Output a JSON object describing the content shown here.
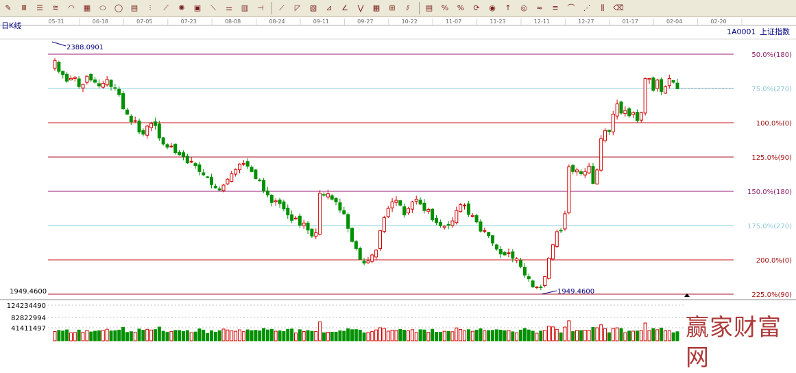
{
  "toolbar": {
    "groups": [
      [
        "draw-pencil-icon",
        "vertical-lines-icon",
        "horizontal-lines-icon",
        "fan-lines-icon",
        "arc-lines-icon",
        "price-channel-icon",
        "ellipse-icon",
        "circle-icon",
        "grid-lines-icon",
        "period-lines-icon",
        "fibonacci-fan-icon",
        "wheel-icon",
        "square-icon",
        "gann-line-icon",
        "speed-resistance-icon",
        "box-icon",
        "bracket-icon"
      ],
      [
        "trend-line-icon",
        "triangle-icon",
        "rectangle-pattern-icon",
        "fan-pattern-icon",
        "angle-icon",
        "zigzag-icon",
        "table-grid-icon",
        "grid-icon",
        "parallel-lines-icon"
      ],
      [
        "percent-lines-icon",
        "percent-icon",
        "percent-text-icon",
        "rotate-icon",
        "gold-icon",
        "arrow-up-icon",
        "gold-ratio-icon",
        "gold-wave-icon",
        "fib-retrace-icon",
        "fib-arc-icon",
        "fib-fan-icon",
        "fib-time-icon",
        "erase-icon"
      ]
    ]
  },
  "chart_data": {
    "type": "candlestick",
    "period_label": "日K线",
    "code": "1A0001",
    "name": "上证指数",
    "x_ticks": [
      "05-31",
      "06-18",
      "07-05",
      "07-23",
      "08-08",
      "08-24",
      "09-11",
      "09-27",
      "10-22",
      "11-07",
      "11-23",
      "12-11",
      "12-27",
      "01-17",
      "02-04",
      "02-20"
    ],
    "high_label": "2388.0901",
    "low_label": "1949.4600",
    "y_left_label": "1949.4600",
    "volume_ticks": [
      "124234490",
      "82822994",
      "41411497"
    ],
    "levels": [
      {
        "label": "50.0%(180)",
        "price": 2389.8,
        "color": "#9a1e74"
      },
      {
        "label": "75.0%(270)",
        "price": 2326.5,
        "color": "#8fd0e0"
      },
      {
        "label": "100.0%(0)",
        "price": 2263.2,
        "color": "#c8141e"
      },
      {
        "label": "125.0%(90)",
        "price": 2199.9,
        "color": "#a81428"
      },
      {
        "label": "150.0%(180)",
        "price": 2136.6,
        "color": "#9a1e74"
      },
      {
        "label": "175.0%(270)",
        "price": 2073.3,
        "color": "#8fd0e0"
      },
      {
        "label": "200.0%(0)",
        "price": 2010.0,
        "color": "#c8141e"
      },
      {
        "label": "225.0%(90)",
        "price": 1946.7,
        "color": "#a81428"
      }
    ],
    "last_close": 2326.5,
    "up_color": "#d00000",
    "down_color": "#009000",
    "closes": [
      2378,
      2358,
      2352,
      2340,
      2345,
      2347,
      2330,
      2334,
      2349,
      2342,
      2338,
      2331,
      2336,
      2343,
      2330,
      2327,
      2315,
      2289,
      2279,
      2265,
      2267,
      2246,
      2242,
      2257,
      2262,
      2258,
      2235,
      2224,
      2218,
      2220,
      2208,
      2204,
      2201,
      2189,
      2192,
      2184,
      2173,
      2167,
      2162,
      2149,
      2143,
      2139,
      2148,
      2159,
      2169,
      2177,
      2187,
      2188,
      2183,
      2173,
      2160,
      2156,
      2137,
      2130,
      2116,
      2119,
      2114,
      2104,
      2093,
      2083,
      2087,
      2074,
      2078,
      2065,
      2054,
      2060,
      2133,
      2130,
      2132,
      2122,
      2117,
      2102,
      2095,
      2068,
      2044,
      2031,
      2011,
      2004,
      2008,
      2019,
      2028,
      2064,
      2088,
      2105,
      2117,
      2120,
      2111,
      2093,
      2105,
      2117,
      2122,
      2113,
      2101,
      2103,
      2084,
      2079,
      2073,
      2072,
      2074,
      2082,
      2101,
      2112,
      2111,
      2094,
      2092,
      2080,
      2063,
      2064,
      2055,
      2041,
      2030,
      2021,
      2019,
      2023,
      2013,
      2012,
      1998,
      1982,
      1975,
      1960,
      1960,
      1959,
      1979,
      2013,
      2038,
      2062,
      2064,
      2095,
      2182,
      2173,
      2176,
      2169,
      2173,
      2183,
      2151,
      2176,
      2234,
      2249,
      2247,
      2279,
      2298,
      2281,
      2286,
      2276,
      2282,
      2267,
      2282,
      2345,
      2345,
      2323,
      2342,
      2321,
      2330,
      2345,
      2338,
      2326
    ]
  }
}
